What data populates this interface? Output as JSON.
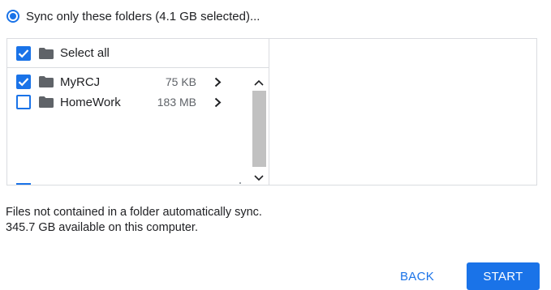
{
  "sync_option": {
    "label": "Sync only these folders (4.1 GB selected)...",
    "selected": true
  },
  "folder_list": {
    "select_all": {
      "label": "Select all",
      "checked": true
    },
    "items": [
      {
        "name": "MyRCJ",
        "size": "75 KB",
        "checked": true
      },
      {
        "name": "HomeWork",
        "size": "183 MB",
        "checked": false
      }
    ]
  },
  "info": {
    "line1": "Files not contained in a folder automatically sync.",
    "line2": "345.7 GB available on this computer."
  },
  "buttons": {
    "back_label": "BACK",
    "start_label": "START"
  },
  "colors": {
    "accent": "#1a73e8",
    "folder": "#5f6368",
    "border": "#dadce0",
    "scroll_thumb": "#c1c1c1"
  },
  "icons": {
    "checkbox_checked": "check-icon",
    "folder": "folder-icon",
    "expand": "chevron-right-icon",
    "scroll_up": "chevron-up-icon",
    "scroll_down": "chevron-down-icon"
  }
}
